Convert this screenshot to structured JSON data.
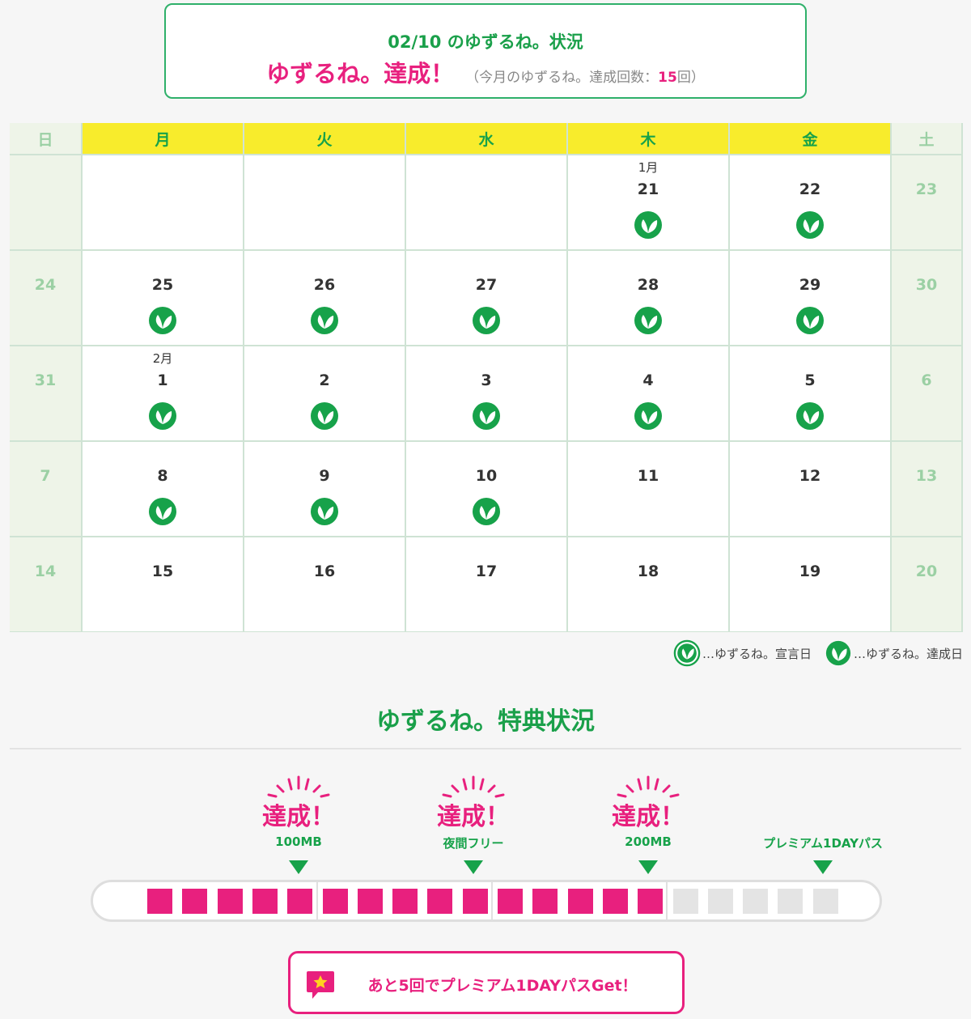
{
  "status": {
    "title": "02/10 のゆずるね。状況",
    "main": "ゆずるね。達成！",
    "sub_prefix": "（今月のゆずるね。達成回数：",
    "count": "15",
    "sub_suffix": "回）"
  },
  "calendar": {
    "weekdays": [
      "日",
      "月",
      "火",
      "水",
      "木",
      "金",
      "土"
    ],
    "weeks": [
      [
        {
          "day": "",
          "weekend": true
        },
        {
          "day": ""
        },
        {
          "day": ""
        },
        {
          "day": ""
        },
        {
          "day": "21",
          "month": "1月",
          "done": true
        },
        {
          "day": "22",
          "done": true
        },
        {
          "day": "23",
          "weekend": true
        }
      ],
      [
        {
          "day": "24",
          "weekend": true
        },
        {
          "day": "25",
          "done": true
        },
        {
          "day": "26",
          "done": true
        },
        {
          "day": "27",
          "done": true
        },
        {
          "day": "28",
          "done": true
        },
        {
          "day": "29",
          "done": true
        },
        {
          "day": "30",
          "weekend": true
        }
      ],
      [
        {
          "day": "31",
          "weekend": true
        },
        {
          "day": "1",
          "month": "2月",
          "done": true
        },
        {
          "day": "2",
          "done": true
        },
        {
          "day": "3",
          "done": true
        },
        {
          "day": "4",
          "done": true
        },
        {
          "day": "5",
          "done": true
        },
        {
          "day": "6",
          "weekend": true
        }
      ],
      [
        {
          "day": "7",
          "weekend": true
        },
        {
          "day": "8",
          "done": true
        },
        {
          "day": "9",
          "done": true
        },
        {
          "day": "10",
          "done": true
        },
        {
          "day": "11"
        },
        {
          "day": "12"
        },
        {
          "day": "13",
          "weekend": true
        }
      ],
      [
        {
          "day": "14",
          "weekend": true
        },
        {
          "day": "15"
        },
        {
          "day": "16"
        },
        {
          "day": "17"
        },
        {
          "day": "18"
        },
        {
          "day": "19"
        },
        {
          "day": "20",
          "weekend": true
        }
      ]
    ]
  },
  "legend": {
    "declared": "…ゆずるね。宣言日",
    "achieved": "…ゆずるね。達成日"
  },
  "perks": {
    "title": "ゆずるね。特典状況",
    "milestones": [
      {
        "label": "100MB",
        "achieved_text": "達成！"
      },
      {
        "label": "夜間フリー",
        "achieved_text": "達成！"
      },
      {
        "label": "200MB",
        "achieved_text": "達成！"
      },
      {
        "label": "プレミアム1DAYパス",
        "achieved_text": ""
      }
    ],
    "progress": {
      "filled": 15,
      "total": 20
    }
  },
  "cta": {
    "label": "あと5回でプレミアム1DAYパスGet！"
  },
  "colors": {
    "green": "#17a24a",
    "pink": "#e8207e",
    "yellow": "#f8ec2c",
    "grey_block": "#e4e4e4"
  }
}
